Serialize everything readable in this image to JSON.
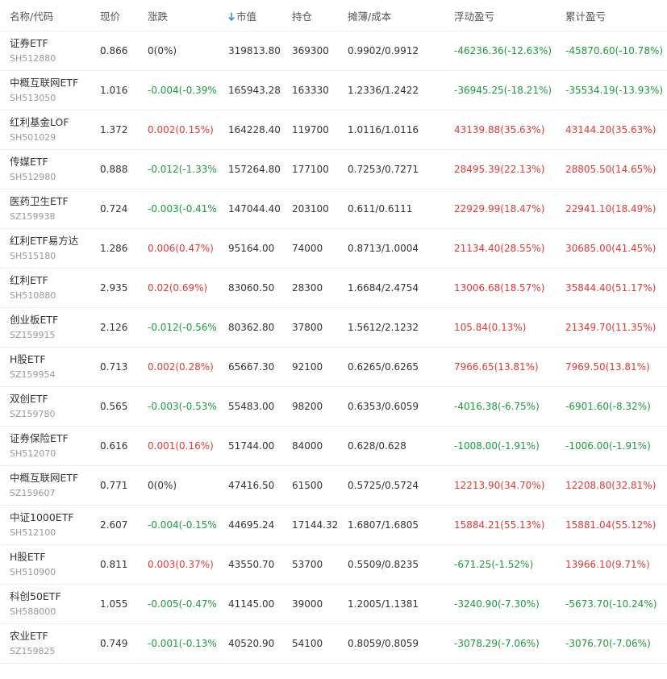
{
  "colors": {
    "up": "#e53935",
    "down": "#1a9c3a",
    "sort_arrow": "#1e88e5"
  },
  "header": {
    "name": "名称/代码",
    "price": "现价",
    "change": "涨跌",
    "market_value": "市值",
    "position": "持仓",
    "cost": "摊薄/成本",
    "float_pl": "浮动盈亏",
    "total_pl": "累计盈亏",
    "sort_icon": "arrow-down-icon"
  },
  "rows": [
    {
      "name": "证券ETF",
      "code": "SH512880",
      "price": "0.866",
      "change": "0(0%)",
      "change_dir": "flat",
      "market_value": "319813.80",
      "position": "369300",
      "cost": "0.9902/0.9912",
      "float_pl": "-46236.36(-12.63%)",
      "float_dir": "down",
      "total_pl": "-45870.60(-10.78%)",
      "total_dir": "down"
    },
    {
      "name": "中概互联网ETF",
      "code": "SH513050",
      "price": "1.016",
      "change": "-0.004(-0.39%)",
      "change_dir": "down",
      "market_value": "165943.28",
      "position": "163330",
      "cost": "1.2336/1.2422",
      "float_pl": "-36945.25(-18.21%)",
      "float_dir": "down",
      "total_pl": "-35534.19(-13.93%)",
      "total_dir": "down"
    },
    {
      "name": "红利基金LOF",
      "code": "SH501029",
      "price": "1.372",
      "change": "0.002(0.15%)",
      "change_dir": "up",
      "market_value": "164228.40",
      "position": "119700",
      "cost": "1.0116/1.0116",
      "float_pl": "43139.88(35.63%)",
      "float_dir": "up",
      "total_pl": "43144.20(35.63%)",
      "total_dir": "up"
    },
    {
      "name": "传媒ETF",
      "code": "SH512980",
      "price": "0.888",
      "change": "-0.012(-1.33%)",
      "change_dir": "down",
      "market_value": "157264.80",
      "position": "177100",
      "cost": "0.7253/0.7271",
      "float_pl": "28495.39(22.13%)",
      "float_dir": "up",
      "total_pl": "28805.50(14.65%)",
      "total_dir": "up"
    },
    {
      "name": "医药卫生ETF",
      "code": "SZ159938",
      "price": "0.724",
      "change": "-0.003(-0.41%)",
      "change_dir": "down",
      "market_value": "147044.40",
      "position": "203100",
      "cost": "0.611/0.6111",
      "float_pl": "22929.99(18.47%)",
      "float_dir": "up",
      "total_pl": "22941.10(18.49%)",
      "total_dir": "up"
    },
    {
      "name": "红利ETF易方达",
      "code": "SH515180",
      "price": "1.286",
      "change": "0.006(0.47%)",
      "change_dir": "up",
      "market_value": "95164.00",
      "position": "74000",
      "cost": "0.8713/1.0004",
      "float_pl": "21134.40(28.55%)",
      "float_dir": "up",
      "total_pl": "30685.00(41.45%)",
      "total_dir": "up"
    },
    {
      "name": "红利ETF",
      "code": "SH510880",
      "price": "2.935",
      "change": "0.02(0.69%)",
      "change_dir": "up",
      "market_value": "83060.50",
      "position": "28300",
      "cost": "1.6684/2.4754",
      "float_pl": "13006.68(18.57%)",
      "float_dir": "up",
      "total_pl": "35844.40(51.17%)",
      "total_dir": "up"
    },
    {
      "name": "创业板ETF",
      "code": "SZ159915",
      "price": "2.126",
      "change": "-0.012(-0.56%)",
      "change_dir": "down",
      "market_value": "80362.80",
      "position": "37800",
      "cost": "1.5612/2.1232",
      "float_pl": "105.84(0.13%)",
      "float_dir": "up",
      "total_pl": "21349.70(11.35%)",
      "total_dir": "up"
    },
    {
      "name": "H股ETF",
      "code": "SZ159954",
      "price": "0.713",
      "change": "0.002(0.28%)",
      "change_dir": "up",
      "market_value": "65667.30",
      "position": "92100",
      "cost": "0.6265/0.6265",
      "float_pl": "7966.65(13.81%)",
      "float_dir": "up",
      "total_pl": "7969.50(13.81%)",
      "total_dir": "up"
    },
    {
      "name": "双创ETF",
      "code": "SZ159780",
      "price": "0.565",
      "change": "-0.003(-0.53%)",
      "change_dir": "down",
      "market_value": "55483.00",
      "position": "98200",
      "cost": "0.6353/0.6059",
      "float_pl": "-4016.38(-6.75%)",
      "float_dir": "down",
      "total_pl": "-6901.60(-8.32%)",
      "total_dir": "down"
    },
    {
      "name": "证券保险ETF",
      "code": "SH512070",
      "price": "0.616",
      "change": "0.001(0.16%)",
      "change_dir": "up",
      "market_value": "51744.00",
      "position": "84000",
      "cost": "0.628/0.628",
      "float_pl": "-1008.00(-1.91%)",
      "float_dir": "down",
      "total_pl": "-1006.00(-1.91%)",
      "total_dir": "down"
    },
    {
      "name": "中概互联网ETF",
      "code": "SZ159607",
      "price": "0.771",
      "change": "0(0%)",
      "change_dir": "flat",
      "market_value": "47416.50",
      "position": "61500",
      "cost": "0.5725/0.5724",
      "float_pl": "12213.90(34.70%)",
      "float_dir": "up",
      "total_pl": "12208.80(32.81%)",
      "total_dir": "up"
    },
    {
      "name": "中证1000ETF",
      "code": "SH512100",
      "price": "2.607",
      "change": "-0.004(-0.15%)",
      "change_dir": "down",
      "market_value": "44695.24",
      "position": "17144.32",
      "cost": "1.6807/1.6805",
      "float_pl": "15884.21(55.13%)",
      "float_dir": "up",
      "total_pl": "15881.04(55.12%)",
      "total_dir": "up"
    },
    {
      "name": "H股ETF",
      "code": "SH510900",
      "price": "0.811",
      "change": "0.003(0.37%)",
      "change_dir": "up",
      "market_value": "43550.70",
      "position": "53700",
      "cost": "0.5509/0.8235",
      "float_pl": "-671.25(-1.52%)",
      "float_dir": "down",
      "total_pl": "13966.10(9.71%)",
      "total_dir": "up"
    },
    {
      "name": "科创50ETF",
      "code": "SH588000",
      "price": "1.055",
      "change": "-0.005(-0.47%)",
      "change_dir": "down",
      "market_value": "41145.00",
      "position": "39000",
      "cost": "1.2005/1.1381",
      "float_pl": "-3240.90(-7.30%)",
      "float_dir": "down",
      "total_pl": "-5673.70(-10.24%)",
      "total_dir": "down"
    },
    {
      "name": "农业ETF",
      "code": "SZ159825",
      "price": "0.749",
      "change": "-0.001(-0.13%)",
      "change_dir": "down",
      "market_value": "40520.90",
      "position": "54100",
      "cost": "0.8059/0.8059",
      "float_pl": "-3078.29(-7.06%)",
      "float_dir": "down",
      "total_pl": "-3076.70(-7.06%)",
      "total_dir": "down"
    }
  ]
}
